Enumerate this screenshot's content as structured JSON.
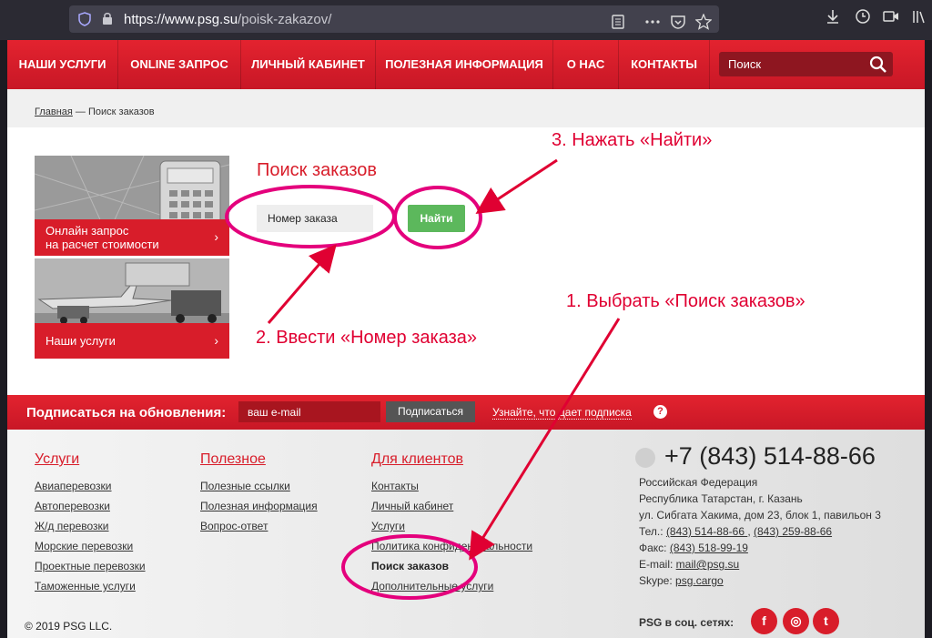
{
  "browser": {
    "url_host": "https://www.psg.su",
    "url_path": "/poisk-zakazov/"
  },
  "nav": {
    "items": [
      "НАШИ УСЛУГИ",
      "ONLINE ЗАПРОС",
      "ЛИЧНЫЙ КАБИНЕТ",
      "ПОЛЕЗНАЯ ИНФОРМАЦИЯ",
      "О НАС",
      "КОНТАКТЫ"
    ],
    "search_placeholder": "Поиск"
  },
  "breadcrumb": {
    "home": "Главная",
    "separator": " — ",
    "current": "Поиск заказов"
  },
  "promos": [
    {
      "line1": "Онлайн запрос",
      "line2": "на расчет стоимости"
    },
    {
      "line1": "Наши услуги",
      "line2": ""
    }
  ],
  "main": {
    "title": "Поиск заказов",
    "order_placeholder": "Номер заказа",
    "find_label": "Найти"
  },
  "subscribe": {
    "label": "Подписаться на обновления:",
    "email_placeholder": "ваш e-mail",
    "button": "Подписаться",
    "link": "Узнайте, что дает подписка"
  },
  "footer": {
    "services": {
      "title": "Услуги",
      "links": [
        "Авиаперевозки",
        "Автоперевозки",
        "Ж/д перевозки",
        "Морские перевозки",
        "Проектные перевозки",
        "Таможенные услуги"
      ]
    },
    "useful": {
      "title": "Полезное",
      "links": [
        "Полезные ссылки",
        "Полезная информация",
        "Вопрос-ответ"
      ]
    },
    "clients": {
      "title": "Для клиентов",
      "links": [
        "Контакты",
        "Личный кабинет",
        "Услуги",
        "Политика конфиденциальности",
        "Поиск заказов",
        "Дополнительные услуги"
      ]
    },
    "contacts": {
      "phone": "+7 (843) 514-88-66",
      "country": "Российская Федерация",
      "region": "Республика Татарстан, г. Казань",
      "address": "ул. Сибгата Хакима, дом 23, блок 1, павильон 3",
      "tel_label": "Тел.: ",
      "tel1": "(843) 514-88-66 ",
      "tel_sep": ", ",
      "tel2": "(843) 259-88-66",
      "fax_label": "Факс: ",
      "fax": "(843) 518-99-19",
      "email_label": "E-mail: ",
      "email": "mail@psg.su",
      "skype_label": "Skype: ",
      "skype": "psg.cargo"
    },
    "copyright": "© 2019 PSG LLC.",
    "social_label": "PSG в соц. сетях:",
    "social": [
      "f",
      "◎",
      "t"
    ]
  },
  "annotations": {
    "step1": "1. Выбрать «Поиск заказов»",
    "step2": "2. Ввести «Номер заказа»",
    "step3": "3. Нажать «Найти»",
    "color": "#e00032",
    "circle_color": "#e4007c"
  }
}
